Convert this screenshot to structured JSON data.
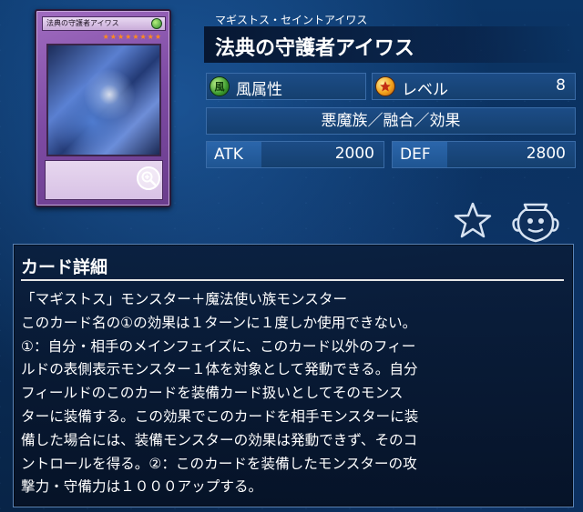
{
  "card": {
    "ruby": "マギストス・セイントアイワス",
    "name": "法典の守護者アイワス",
    "attribute_label": "風属性",
    "attribute_icon_char": "風",
    "attribute_color": "#3c9a2e",
    "level_label": "レベル",
    "level_value": "8",
    "type_line": "悪魔族／融合／効果",
    "atk_label": "ATK",
    "atk_value": "2000",
    "def_label": "DEF",
    "def_value": "2800"
  },
  "card_image": {
    "frame_color": "#7d4aa3",
    "stars": "★★★★★★★★"
  },
  "icons": {
    "zoom": "zoom-icon",
    "favorite": "star-icon",
    "deck": "deck-jar-icon",
    "level": "level-star-icon",
    "attribute": "wind-attribute-icon"
  },
  "detail": {
    "title": "カード詳細",
    "lines": [
      "「マギストス」モンスター＋魔法使い族モンスター",
      "このカード名の①の効果は１ターンに１度しか使用できない。",
      "①：自分・相手のメインフェイズに、このカード以外のフィー",
      "ルドの表側表示モンスター１体を対象として発動できる。自分",
      "フィールドのこのカードを装備カード扱いとしてそのモンス",
      "ターに装備する。この効果でこのカードを相手モンスターに装",
      "備した場合には、装備モンスターの効果は発動できず、そのコ",
      "ントロールを得る。②：このカードを装備したモンスターの攻",
      "撃力・守備力は１０００アップする。"
    ]
  }
}
